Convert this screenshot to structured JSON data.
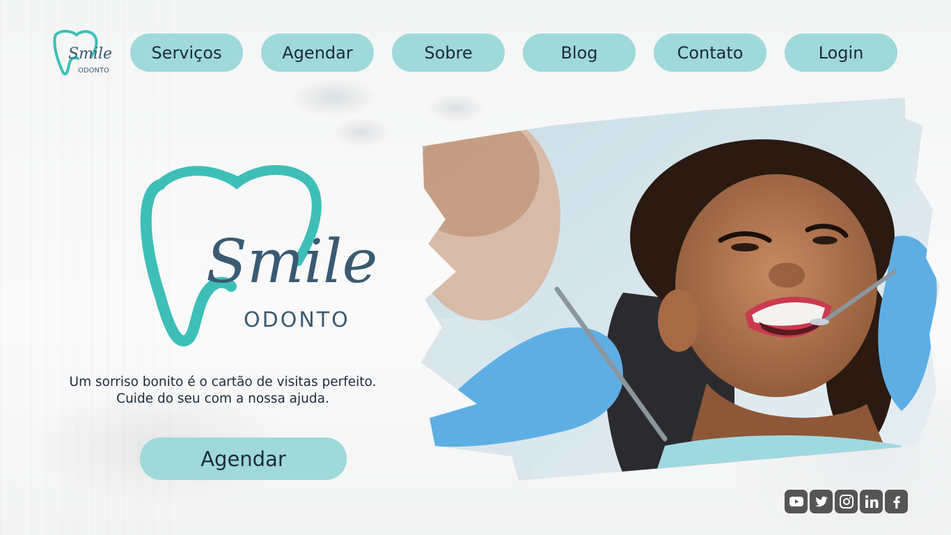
{
  "brand": {
    "name": "Smile",
    "subtitle": "ODONTO",
    "accent": "#3dbfb8",
    "text_color": "#3a5a72"
  },
  "nav": {
    "items": [
      "Serviços",
      "Agendar",
      "Sobre",
      "Blog",
      "Contato",
      "Login"
    ],
    "button_color": "#9fd9d9"
  },
  "hero": {
    "tagline_line1": "Um sorriso bonito é o cartão de visitas perfeito.",
    "tagline_line2": "Cuide do seu com a nossa ajuda.",
    "cta_label": "Agendar"
  },
  "socials": [
    "youtube-icon",
    "twitter-icon",
    "instagram-icon",
    "linkedin-icon",
    "facebook-icon"
  ]
}
